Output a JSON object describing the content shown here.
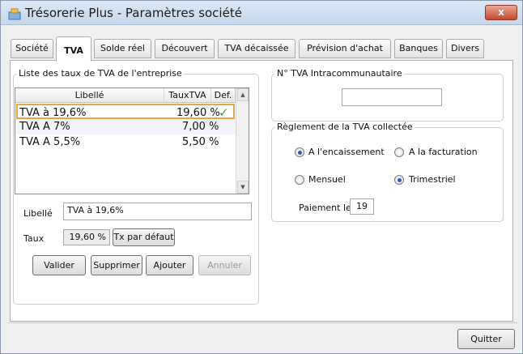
{
  "window": {
    "title": "Trésorerie Plus - Paramètres société",
    "close_label": "x"
  },
  "tabs": [
    {
      "label": "Société"
    },
    {
      "label": "TVA"
    },
    {
      "label": "Solde réel"
    },
    {
      "label": "Découvert"
    },
    {
      "label": "TVA décaissée"
    },
    {
      "label": "Prévision d'achat"
    },
    {
      "label": "Banques"
    },
    {
      "label": "Divers"
    }
  ],
  "taux_group": {
    "legend": "Liste des taux de TVA de l'entreprise",
    "headers": {
      "libelle": "Libellé",
      "taux": "TauxTVA",
      "def": "Def."
    },
    "rows": [
      {
        "libelle": "TVA à 19,6%",
        "taux": "19,60 %",
        "default_mark": "✓"
      },
      {
        "libelle": "TVA A 7%",
        "taux": "7,00 %",
        "default_mark": ""
      },
      {
        "libelle": "TVA A 5,5%",
        "taux": "5,50 %",
        "default_mark": ""
      }
    ],
    "libelle_label": "Libellé",
    "libelle_value": "TVA à 19,6%",
    "taux_label": "Taux",
    "taux_value": "19,60 %",
    "tx_defaut_label": "Tx par défaut",
    "buttons": {
      "valider": "Valider",
      "supprimer": "Supprimer",
      "ajouter": "Ajouter",
      "annuler": "Annuler"
    }
  },
  "intracom": {
    "legend": "N° TVA Intracommunautaire",
    "value": ""
  },
  "reglement": {
    "legend": "Règlement de la TVA collectée",
    "encaissement": "A l'encaissement",
    "facturation": "A la facturation",
    "mensuel": "Mensuel",
    "trimestriel": "Trimestriel",
    "paiement_label": "Paiement le",
    "paiement_value": "19"
  },
  "footer": {
    "quitter": "Quitter"
  },
  "colors": {
    "selection_border": "#e7a648",
    "check_green": "#3aa02a",
    "radio_dot": "#2a5fb0"
  }
}
